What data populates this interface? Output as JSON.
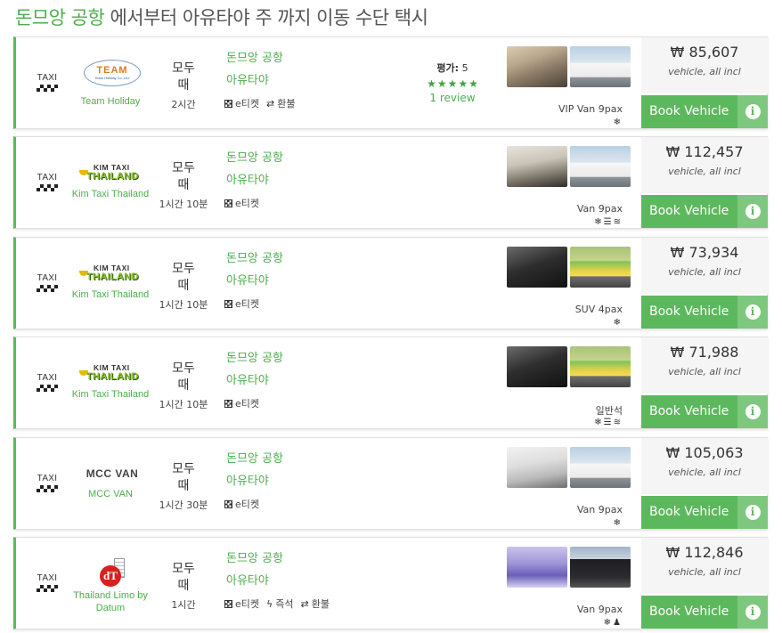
{
  "header": {
    "title_origin": "돈므앙 공항",
    "title_rest": " 에서부터 아유타야 주 까지 이동 수단 택시"
  },
  "colors": {
    "accent": "#5cb85c",
    "link": "#4cae4c",
    "price_bg": "#f5f5f5"
  },
  "common": {
    "taxi_label": "TAXI",
    "when": "모두 때",
    "price_note": "vehicle, all incl",
    "book_label": "Book Vehicle",
    "info_icon": "i"
  },
  "results": [
    {
      "company": "Team Holiday",
      "logo": {
        "type": "team",
        "line1": "TEAM",
        "line2": "Team Holiday Co.,Ltd."
      },
      "duration": "2시간",
      "from": "돈므앙 공항",
      "to": "아유타야",
      "features": [
        {
          "icon": "qr-icon",
          "label": "e티켓"
        },
        {
          "icon": "exchange-icon",
          "glyph": "⇄",
          "label": "환불"
        }
      ],
      "rating": {
        "label": "평가:",
        "value": "5",
        "stars": 5,
        "reviews": "1 review"
      },
      "photos": [
        "interior-beige",
        "white-van"
      ],
      "vehicle": "VIP Van 9pax",
      "amenities": [
        {
          "name": "ac-icon",
          "glyph": "❄"
        }
      ],
      "price": "₩ 85,607"
    },
    {
      "company": "Kim Taxi Thailand",
      "logo": {
        "type": "kim",
        "line1": "KIM TAXI",
        "line2": "THAILAND"
      },
      "duration": "1시간 10분",
      "from": "돈므앙 공항",
      "to": "아유타야",
      "features": [
        {
          "icon": "qr-icon",
          "label": "e티켓"
        }
      ],
      "photos": [
        "interior-grey",
        "white-van"
      ],
      "vehicle": "Van 9pax",
      "amenities": [
        {
          "name": "ac-icon",
          "glyph": "❄"
        },
        {
          "name": "luggage-icon",
          "glyph": "☰"
        },
        {
          "name": "wifi-icon",
          "glyph": "≋"
        }
      ],
      "price": "₩ 112,457"
    },
    {
      "company": "Kim Taxi Thailand",
      "logo": {
        "type": "kim",
        "line1": "KIM TAXI",
        "line2": "THAILAND"
      },
      "duration": "1시간 10분",
      "from": "돈므앙 공항",
      "to": "아유타야",
      "features": [
        {
          "icon": "qr-icon",
          "label": "e티켓"
        }
      ],
      "photos": [
        "interior-dark",
        "green-yellow-taxi"
      ],
      "vehicle": "SUV 4pax",
      "amenities": [
        {
          "name": "ac-icon",
          "glyph": "❄"
        }
      ],
      "price": "₩ 73,934"
    },
    {
      "company": "Kim Taxi Thailand",
      "logo": {
        "type": "kim",
        "line1": "KIM TAXI",
        "line2": "THAILAND"
      },
      "duration": "1시간 10분",
      "from": "돈므앙 공항",
      "to": "아유타야",
      "features": [
        {
          "icon": "qr-icon",
          "label": "e티켓"
        }
      ],
      "photos": [
        "interior-dark",
        "green-yellow-taxi"
      ],
      "vehicle": "일반석",
      "amenities": [
        {
          "name": "ac-icon",
          "glyph": "❄"
        },
        {
          "name": "luggage-icon",
          "glyph": "☰"
        },
        {
          "name": "wifi-icon",
          "glyph": "≋"
        }
      ],
      "price": "₩ 71,988"
    },
    {
      "company": "MCC VAN",
      "logo": {
        "type": "mcc",
        "line1": "MCC VAN"
      },
      "duration": "1시간 30분",
      "from": "돈므앙 공항",
      "to": "아유타야",
      "features": [
        {
          "icon": "qr-icon",
          "label": "e티켓"
        }
      ],
      "photos": [
        "interior-white",
        "white-van"
      ],
      "vehicle": "Van 9pax",
      "amenities": [
        {
          "name": "ac-icon",
          "glyph": "❄"
        }
      ],
      "price": "₩ 105,063"
    },
    {
      "company": "Thailand Limo by Datum",
      "logo": {
        "type": "dt",
        "line1": "dT"
      },
      "duration": "1시간",
      "from": "돈므앙 공항",
      "to": "아유타야",
      "features": [
        {
          "icon": "qr-icon",
          "label": "e티켓"
        },
        {
          "icon": "bolt-icon",
          "glyph": "ϟ",
          "label": "즉석"
        },
        {
          "icon": "exchange-icon",
          "glyph": "⇄",
          "label": "환불"
        }
      ],
      "photos": [
        "interior-purple",
        "black-van"
      ],
      "vehicle": "Van 9pax",
      "amenities": [
        {
          "name": "ac-icon",
          "glyph": "❄"
        },
        {
          "name": "driver-icon",
          "glyph": "♟"
        }
      ],
      "price": "₩ 112,846"
    }
  ]
}
